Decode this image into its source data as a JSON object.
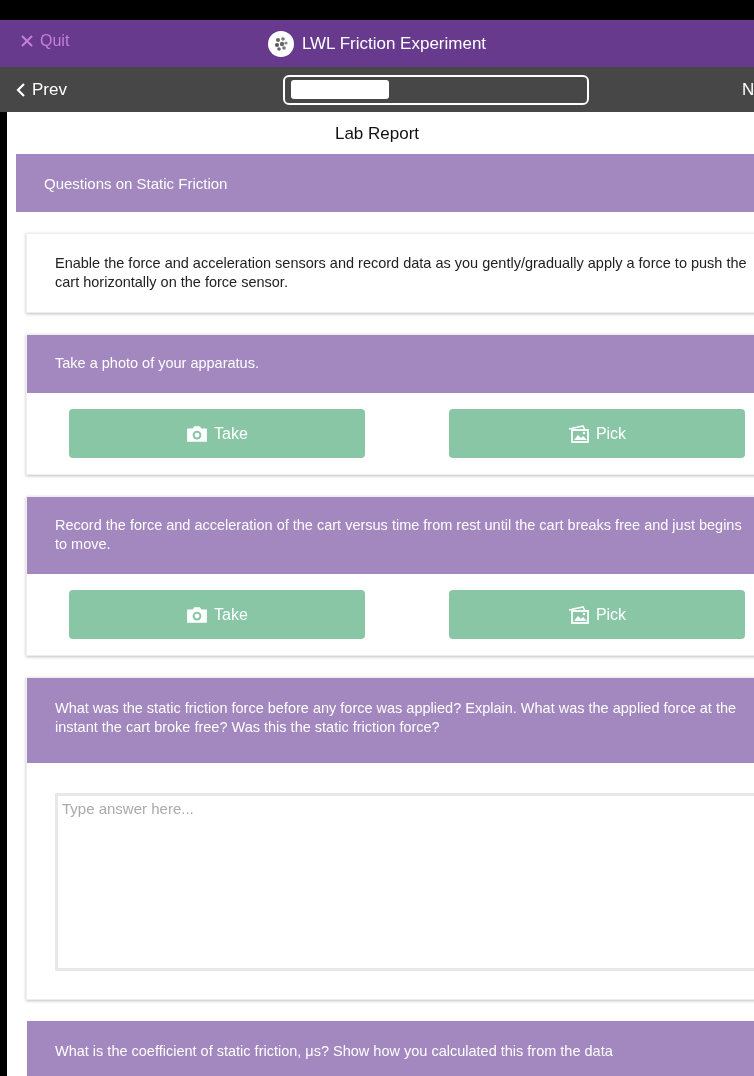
{
  "header": {
    "quit": "Quit",
    "title": "LWL Friction Experiment"
  },
  "nav": {
    "prev": "Prev",
    "next": "N"
  },
  "page_title": "Lab Report",
  "section": {
    "title": "Questions on Static Friction"
  },
  "items": [
    {
      "kind": "text",
      "text": "Enable the force and acceleration sensors and record data as you gently/gradually apply a force to push the cart horizontally on the force sensor."
    },
    {
      "kind": "photo",
      "prompt": "Take a photo of your apparatus.",
      "take": "Take",
      "pick": "Pick"
    },
    {
      "kind": "photo",
      "prompt": "Record the force and acceleration of the cart versus time from rest until the cart breaks free and just begins to move.",
      "take": "Take",
      "pick": "Pick"
    },
    {
      "kind": "answer",
      "prompt": "What was the static friction force before any force was applied? Explain. What was the applied force at the instant the cart broke free? Was this the static friction force?",
      "placeholder": "Type answer here..."
    },
    {
      "kind": "answer",
      "prompt": "What is the coefficient of static friction, μs? Show how you calculated this from the data"
    }
  ]
}
